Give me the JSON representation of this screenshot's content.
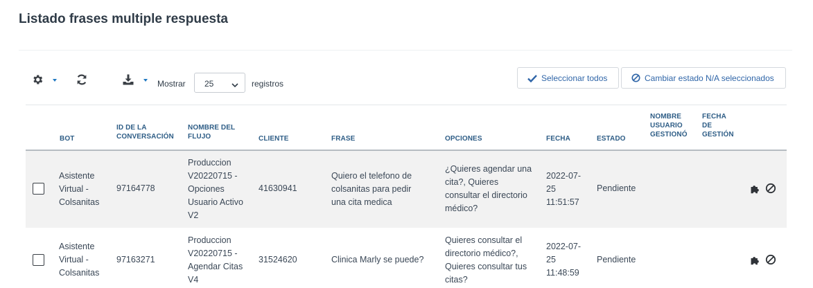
{
  "page": {
    "title": "Listado frases multiple respuesta"
  },
  "toolbar": {
    "settings_icon": "gear-icon",
    "refresh_icon": "refresh-icon",
    "download_icon": "download-icon",
    "show_label": "Mostrar",
    "page_size": "25",
    "records_label": "registros",
    "select_all_label": "Seleccionar todos",
    "change_status_label": "Cambiar estado N/A seleccionados",
    "accent_color": "#1f78c1"
  },
  "table": {
    "headers": {
      "bot": "BOT",
      "conv_id": [
        "ID DE LA",
        "CONVERSACIÓN"
      ],
      "flow": [
        "NOMBRE DEL",
        "FLUJO"
      ],
      "client": "CLIENTE",
      "phrase": "FRASE",
      "options": "OPCIONES",
      "date": "FECHA",
      "status": "ESTADO",
      "user": [
        "NOMBRE",
        "USUARIO",
        "GESTIONÓ"
      ],
      "mgmt_date": [
        "FECHA",
        "DE",
        "GESTIÓN"
      ]
    },
    "rows": [
      {
        "bot": [
          "Asistente",
          "Virtual -",
          "Colsanitas"
        ],
        "conv_id": "97164778",
        "flow": [
          "Produccion",
          "V20220715 -",
          "Opciones",
          "Usuario Activo",
          "V2"
        ],
        "client": "41630941",
        "phrase": [
          "Quiero el telefono de",
          "colsanitas para pedir",
          "una cita medica"
        ],
        "options": [
          "¿Quieres agendar una",
          "cita?, Quieres",
          "consultar el directorio",
          "médico?"
        ],
        "date": [
          "2022-07-",
          "25",
          "11:51:57"
        ],
        "status": "Pendiente",
        "user": "",
        "mgmt_date": ""
      },
      {
        "bot": [
          "Asistente",
          "Virtual -",
          "Colsanitas"
        ],
        "conv_id": "97163271",
        "flow": [
          "Produccion",
          "V20220715 -",
          "Agendar Citas",
          "V4"
        ],
        "client": "31524620",
        "phrase": [
          "Clinica Marly se puede?"
        ],
        "options": [
          "Quieres consultar el",
          "directorio médico?,",
          "Quieres consultar tus",
          "citas?"
        ],
        "date": [
          "2022-07-",
          "25",
          "11:48:59"
        ],
        "status": "Pendiente",
        "user": "",
        "mgmt_date": ""
      }
    ],
    "row_actions": [
      "puzzle-icon",
      "ban-icon"
    ]
  }
}
